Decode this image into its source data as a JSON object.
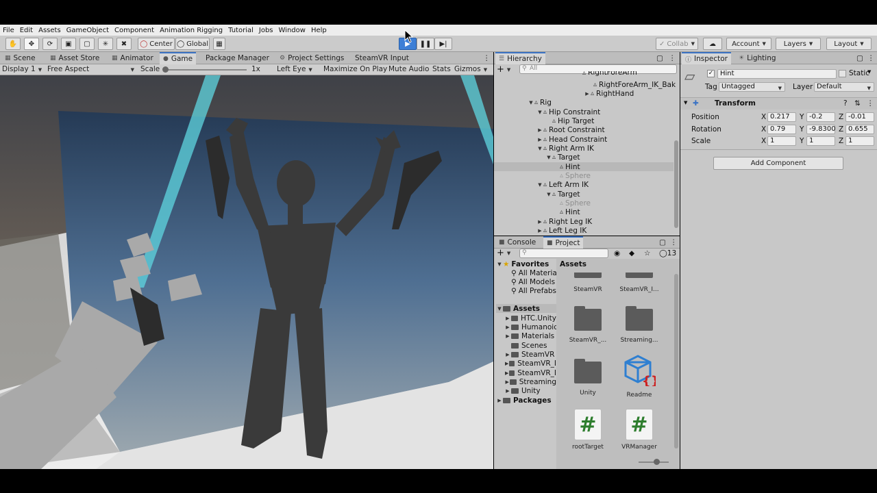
{
  "menu": [
    "File",
    "Edit",
    "Assets",
    "GameObject",
    "Component",
    "Animation Rigging",
    "Tutorial",
    "Jobs",
    "Window",
    "Help"
  ],
  "toolbar": {
    "pivot": "Center",
    "space": "Global",
    "collab": "Collab",
    "account": "Account",
    "layers": "Layers",
    "layout": "Layout"
  },
  "game_tabs": [
    "Scene",
    "Asset Store",
    "Animator",
    "Game",
    "Package Manager",
    "Project Settings",
    "SteamVR Input"
  ],
  "game_controls": {
    "display": "Display 1",
    "aspect": "Free Aspect",
    "scale_label": "Scale",
    "scale_value": "1x",
    "eye": "Left Eye",
    "maximize": "Maximize On Play",
    "mute": "Mute Audio",
    "stats": "Stats",
    "gizmos": "Gizmos"
  },
  "hierarchy": {
    "tab": "Hierarchy",
    "search_placeholder": "All",
    "rows": [
      {
        "label": "RightForeArm",
        "indent": 8
      },
      {
        "label": "RightForeArm_IK_Bak",
        "indent": 9
      },
      {
        "label": "RightHand",
        "indent": 8
      },
      {
        "label": "Rig",
        "indent": 4
      },
      {
        "label": "Hip Constraint",
        "indent": 5
      },
      {
        "label": "Hip Target",
        "indent": 6
      },
      {
        "label": "Root Constraint",
        "indent": 5
      },
      {
        "label": "Head Constraint",
        "indent": 5
      },
      {
        "label": "Right Arm IK",
        "indent": 5
      },
      {
        "label": "Target",
        "indent": 6
      },
      {
        "label": "Hint",
        "indent": 7
      },
      {
        "label": "Sphere",
        "indent": 7
      },
      {
        "label": "Left Arm IK",
        "indent": 5
      },
      {
        "label": "Target",
        "indent": 6
      },
      {
        "label": "Sphere",
        "indent": 7
      },
      {
        "label": "Hint",
        "indent": 7
      },
      {
        "label": "Right Leg IK",
        "indent": 5
      },
      {
        "label": "Left Leg IK",
        "indent": 5
      }
    ]
  },
  "project": {
    "tabs": [
      "Console",
      "Project"
    ],
    "hidden_count": "13",
    "favorites_label": "Favorites",
    "favorites": [
      "All Materia",
      "All Models",
      "All Prefabs"
    ],
    "assets_label": "Assets",
    "asset_folders": [
      "HTC.Unity",
      "Humanoid",
      "Materials",
      "Scenes",
      "SteamVR",
      "SteamVR_I",
      "SteamVR_I",
      "Streaming",
      "Unity"
    ],
    "packages_label": "Packages",
    "grid_header": "Assets",
    "tiles": [
      "SteamVR",
      "SteamVR_I...",
      "SteamVR_...",
      "Streaming...",
      "Unity",
      "Readme",
      "rootTarget",
      "VRManager"
    ]
  },
  "inspector": {
    "tabs": [
      "Inspector",
      "Lighting"
    ],
    "object_name": "Hint",
    "static_label": "Static",
    "tag_label": "Tag",
    "tag_value": "Untagged",
    "layer_label": "Layer",
    "layer_value": "Default",
    "component": "Transform",
    "position_label": "Position",
    "rotation_label": "Rotation",
    "scale_label": "Scale",
    "axis_x": "X",
    "axis_y": "Y",
    "axis_z": "Z",
    "position": {
      "x": "0.217",
      "y": "-0.2",
      "z": "-0.01"
    },
    "rotation": {
      "x": "0.79",
      "y": "-9.8300",
      "z": "0.655"
    },
    "scale": {
      "x": "1",
      "y": "1",
      "z": "1"
    },
    "add_component": "Add Component"
  },
  "colors": {
    "accent": "#3a72c4",
    "panel_bg": "#c8c8c8",
    "play_blue": "#3d7fd6"
  }
}
